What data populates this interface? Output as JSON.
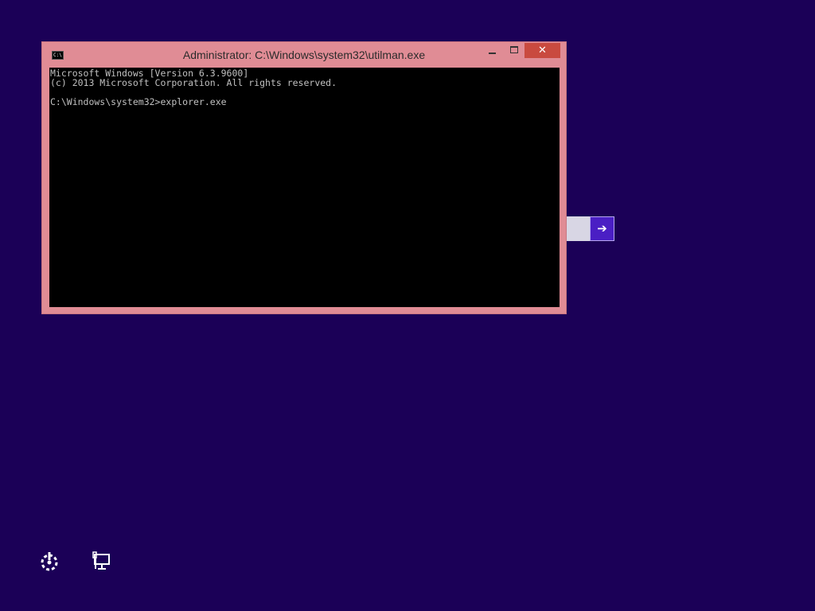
{
  "window": {
    "title": "Administrator: C:\\Windows\\system32\\utilman.exe",
    "icon_label": "C:\\",
    "close_glyph": "✕"
  },
  "console": {
    "lines": [
      "Microsoft Windows [Version 6.3.9600]",
      "(c) 2013 Microsoft Corporation. All rights reserved.",
      "",
      "C:\\Windows\\system32>explorer.exe"
    ]
  },
  "login": {
    "submit_glyph": "➔"
  },
  "icons": {
    "ease_of_access": "ease-of-access-icon",
    "network": "network-icon"
  },
  "colors": {
    "desktop_bg": "#1b0057",
    "window_frame": "#e08c95",
    "close_button": "#c94a3f",
    "console_bg": "#000000",
    "console_text": "#c0c0c0",
    "submit_button": "#4a1fc4"
  }
}
